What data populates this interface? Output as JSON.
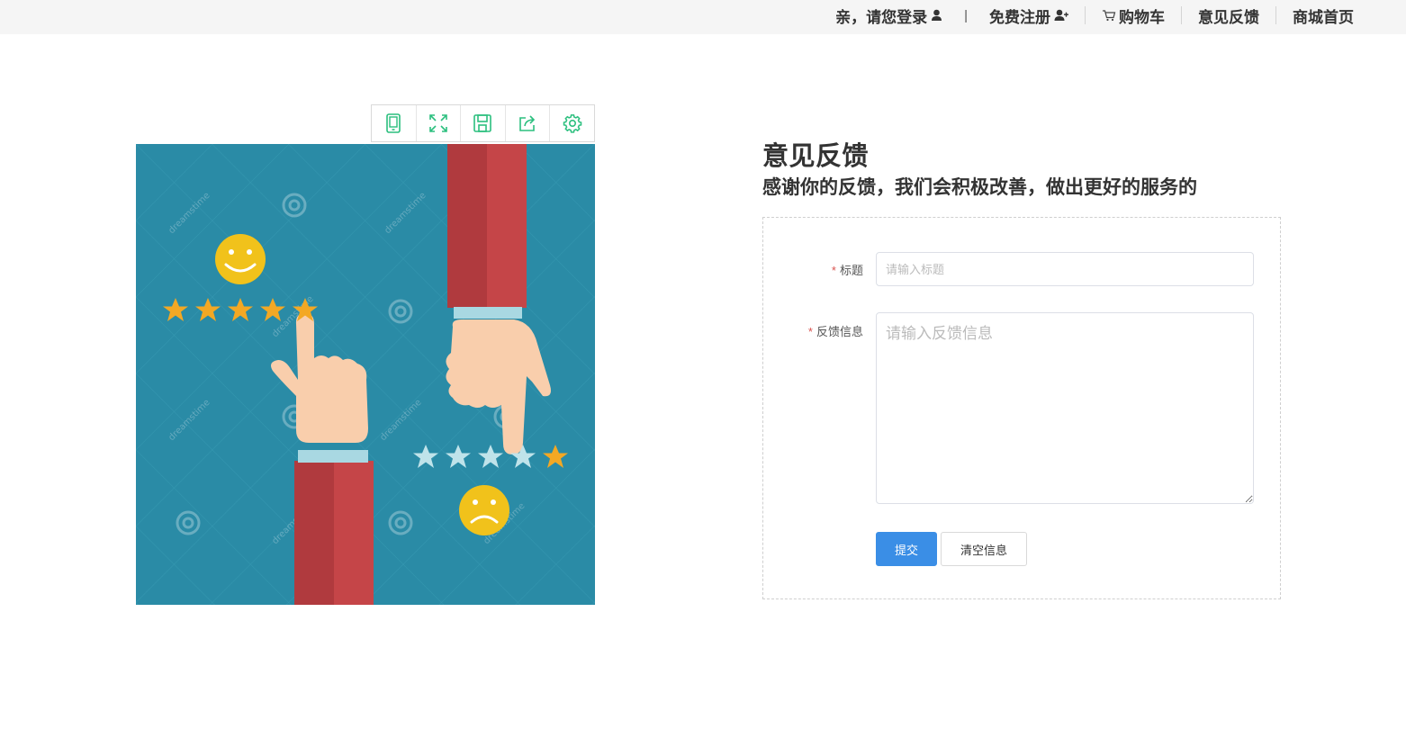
{
  "topnav": {
    "login": "亲，请您登录",
    "divider": "|",
    "register": "免费注册",
    "cart": "购物车",
    "feedback": "意见反馈",
    "home": "商城首页"
  },
  "toolbox": {
    "tools": [
      "tablet-icon",
      "fullscreen-icon",
      "save-icon",
      "share-icon",
      "gear-icon"
    ],
    "icon_color": "#2bbf7e"
  },
  "illustration": {
    "watermark": "dreamstime",
    "background_color": "#2a8ba6",
    "top_rating": "5 of 5 stars",
    "bottom_rating": "1 of 5 stars"
  },
  "feedback": {
    "title": "意见反馈",
    "subtitle": "感谢你的反馈，我们会积极改善，做出更好的服务的",
    "form": {
      "title_label": "标题",
      "title_placeholder": "请输入标题",
      "content_label": "反馈信息",
      "content_placeholder": "请输入反馈信息",
      "required_mark": "*",
      "submit_label": "提交",
      "clear_label": "清空信息"
    }
  },
  "colors": {
    "primary": "#3a8ee6",
    "required": "#d9534f",
    "topbar_bg": "#f5f5f5"
  }
}
